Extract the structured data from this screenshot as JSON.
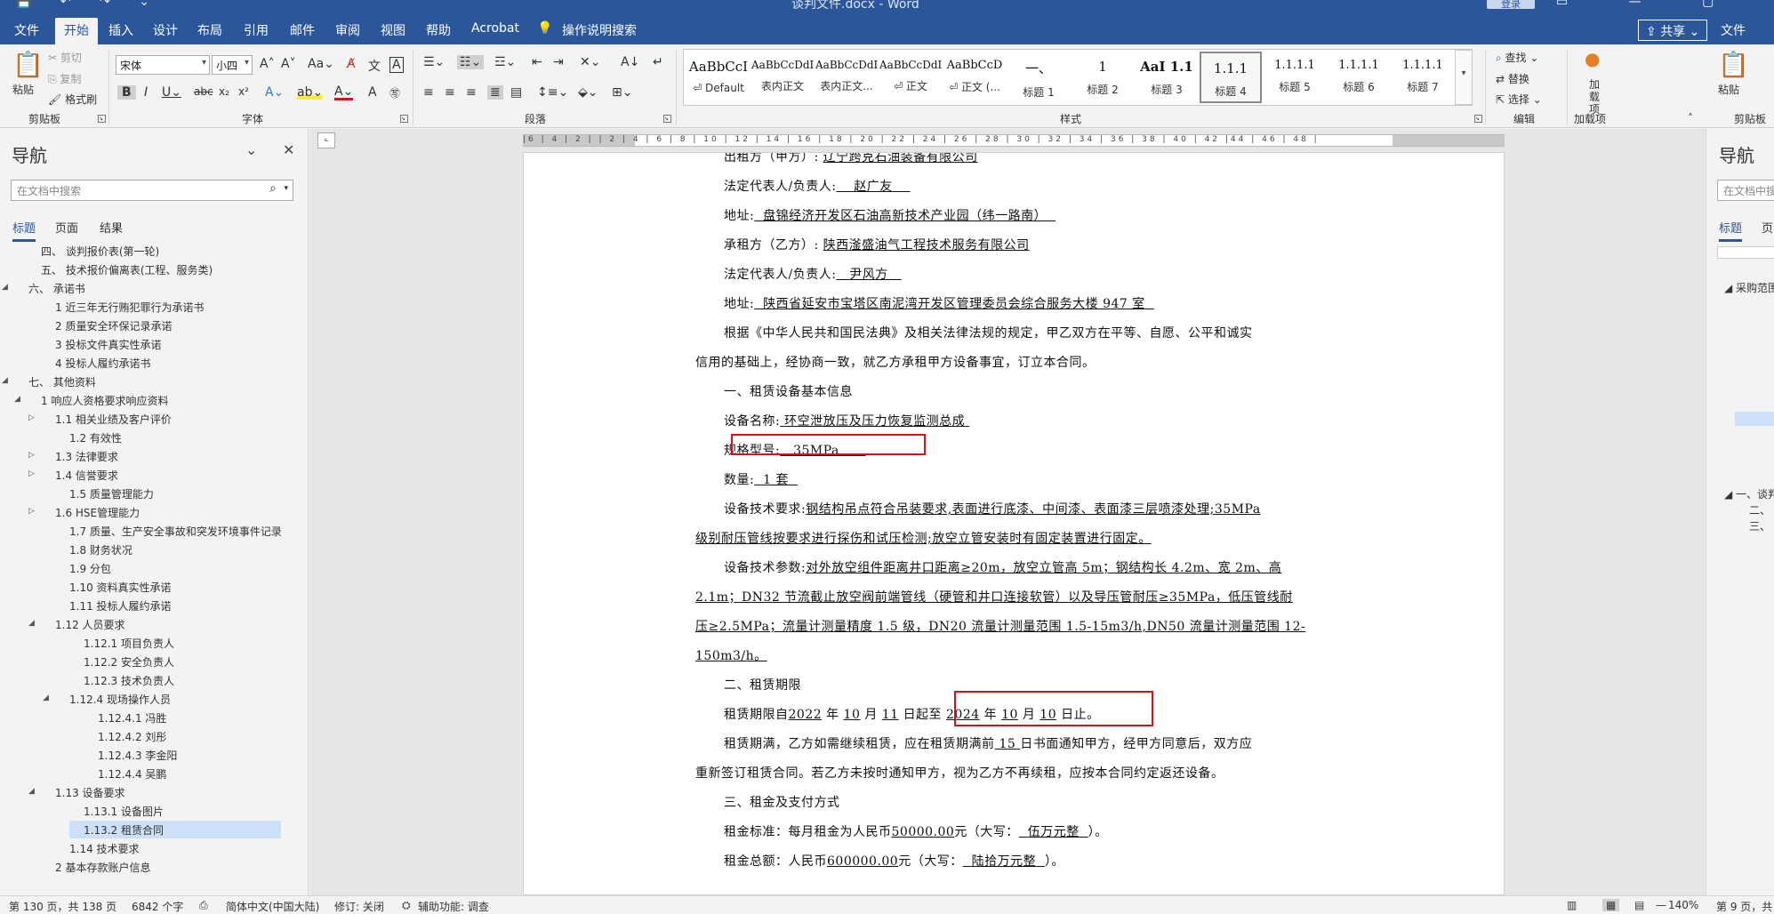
{
  "titlebar": {
    "title": "谈判文件.docx - Word",
    "login": "登录",
    "quick_access": "💾 ↶ ↷ ⌄"
  },
  "menu": {
    "tabs": [
      "文件",
      "开始",
      "插入",
      "设计",
      "布局",
      "引用",
      "邮件",
      "审阅",
      "视图",
      "帮助",
      "Acrobat"
    ],
    "tell_me": "操作说明搜索",
    "share": "共享",
    "right_file": "文件"
  },
  "ribbon": {
    "clipboard": {
      "paste": "粘贴",
      "cut": "剪切",
      "copy": "复制",
      "format_painter": "格式刷",
      "label": "剪贴板"
    },
    "font": {
      "name": "宋体",
      "size": "小四",
      "label": "字体"
    },
    "paragraph": {
      "label": "段落"
    },
    "styles": {
      "label": "样式",
      "items": [
        {
          "sample": "AaBbCcI",
          "name": "⏎ Default"
        },
        {
          "sample": "AaBbCcDdI",
          "name": "表内正文"
        },
        {
          "sample": "AaBbCcDdI",
          "name": "表内正文..."
        },
        {
          "sample": "AaBbCcDdI",
          "name": "⏎ 正文"
        },
        {
          "sample": "AaBbCcD",
          "name": "⏎ 正文 (..."
        },
        {
          "sample": "一、",
          "name": "标题 1"
        },
        {
          "sample": "1",
          "name": "标题 2"
        },
        {
          "sample": "AaI",
          "name": "标题 3"
        },
        {
          "sample": "1.1.1",
          "name": "标题 4"
        },
        {
          "sample": "1.1.1.1",
          "name": "标题 5"
        },
        {
          "sample": "1.1.1.1",
          "name": "标题 6"
        },
        {
          "sample": "1.1.1.1",
          "name": "标题 7"
        }
      ],
      "level_samples": [
        "1.1",
        "1.1",
        "1.1"
      ]
    },
    "editing": {
      "find": "查找",
      "replace": "替换",
      "select": "选择",
      "label": "编辑"
    },
    "addins": {
      "button": "加载项",
      "label": "加载项"
    },
    "right_partial": {
      "paste": "粘贴",
      "label": "剪贴板"
    }
  },
  "nav": {
    "title": "导航",
    "search_placeholder": "在文档中搜索",
    "tabs": [
      "标题",
      "页面",
      "结果"
    ],
    "tree": [
      {
        "text": "四、 谈判报价表(第一轮)",
        "level": 1,
        "twist": ""
      },
      {
        "text": "五、 技术报价偏离表(工程、服务类)",
        "level": 1,
        "twist": ""
      },
      {
        "text": "六、 承诺书",
        "level": 0,
        "twist": "◢"
      },
      {
        "text": "1 近三年无行贿犯罪行为承诺书",
        "level": 2,
        "twist": ""
      },
      {
        "text": "2 质量安全环保记录承诺",
        "level": 2,
        "twist": ""
      },
      {
        "text": "3 投标文件真实性承诺",
        "level": 2,
        "twist": ""
      },
      {
        "text": "4 投标人履约承诺书",
        "level": 2,
        "twist": ""
      },
      {
        "text": "七、 其他资料",
        "level": 0,
        "twist": "◢"
      },
      {
        "text": "1 响应人资格要求响应资料",
        "level": 1,
        "twist": "◢"
      },
      {
        "text": "1.1 相关业绩及客户评价",
        "level": 2,
        "twist": "▷"
      },
      {
        "text": "1.2 有效性",
        "level": 3,
        "twist": ""
      },
      {
        "text": "1.3 法律要求",
        "level": 2,
        "twist": "▷"
      },
      {
        "text": "1.4 信誉要求",
        "level": 2,
        "twist": "▷"
      },
      {
        "text": "1.5 质量管理能力",
        "level": 3,
        "twist": ""
      },
      {
        "text": "1.6 HSE管理能力",
        "level": 2,
        "twist": "▷"
      },
      {
        "text": "1.7 质量、生产安全事故和突发环境事件记录",
        "level": 3,
        "twist": ""
      },
      {
        "text": "1.8 财务状况",
        "level": 3,
        "twist": ""
      },
      {
        "text": "1.9 分包",
        "level": 3,
        "twist": ""
      },
      {
        "text": "1.10 资料真实性承诺",
        "level": 3,
        "twist": ""
      },
      {
        "text": "1.11 投标人履约承诺",
        "level": 3,
        "twist": ""
      },
      {
        "text": "1.12 人员要求",
        "level": 2,
        "twist": "◢"
      },
      {
        "text": "1.12.1 项目负责人",
        "level": 4,
        "twist": ""
      },
      {
        "text": "1.12.2 安全负责人",
        "level": 4,
        "twist": ""
      },
      {
        "text": "1.12.3 技术负责人",
        "level": 4,
        "twist": ""
      },
      {
        "text": "1.12.4 现场操作人员",
        "level": 3,
        "twist": "◢"
      },
      {
        "text": "1.12.4.1 冯胜",
        "level": 5,
        "twist": ""
      },
      {
        "text": "1.12.4.2 刘彤",
        "level": 5,
        "twist": ""
      },
      {
        "text": "1.12.4.3 李金阳",
        "level": 5,
        "twist": ""
      },
      {
        "text": "1.12.4.4 吴鹏",
        "level": 5,
        "twist": ""
      },
      {
        "text": "1.13 设备要求",
        "level": 2,
        "twist": "◢"
      },
      {
        "text": "1.13.1 设备图片",
        "level": 4,
        "twist": ""
      },
      {
        "text": "1.13.2 租赁合同",
        "level": 4,
        "twist": "",
        "selected": true
      },
      {
        "text": "1.14 技术要求",
        "level": 3,
        "twist": ""
      },
      {
        "text": "2 基本存款账户信息",
        "level": 2,
        "twist": ""
      }
    ]
  },
  "ruler": {
    "text": "|6 | 4 | 2 |  | 2 | 4 | 6 | 8 | 10 | 12 | 14 | 16 | 18 | 20 | 22 | 24 | 26 | 28 | 30 | 32 | 34 | 36 | 38 | 40 | 42 |44 | 46 | 48 |"
  },
  "doc": {
    "line_top": {
      "label": "出租方（甲方）:",
      "value": "辽宁跨克石油装备有限公司"
    },
    "lessor_rep": {
      "label": "法定代表人/负责人:",
      "value": "赵广友"
    },
    "lessor_addr": {
      "label": "地址:",
      "value": "盘锦经济开发区石油高新技术产业园（纬一路南）"
    },
    "lessee": {
      "label": "承租方（乙方）:",
      "value": "陕西滏盛油气工程技术服务有限公司"
    },
    "lessee_rep": {
      "label": "法定代表人/负责人:",
      "value": "尹风方"
    },
    "lessee_addr": {
      "label": "地址:",
      "value": "陕西省延安市宝塔区南泥湾开发区管理委员会综合服务大楼 947 室"
    },
    "preamble_1": "根据《中华人民共和国民法典》及相关法律法规的规定，甲乙双方在平等、自愿、公平和诚实",
    "preamble_2": "信用的基础上，经协商一致，就乙方承租甲方设备事宜，订立本合同。",
    "sec1": "一、租赁设备基本信息",
    "equip_name": {
      "label": "设备名称:",
      "value": "环空泄放压及压力恢复监测总成"
    },
    "spec": {
      "label": "规格型号:",
      "value": "35MPa"
    },
    "qty": {
      "label": "数量:",
      "value": "1 套"
    },
    "req_label": "设备技术要求:",
    "req_1": "钢结构吊点符合吊装要求,表面进行底漆、中间漆、表面漆三层喷漆处理;35MPa",
    "req_2": "级别耐压管线按要求进行探伤和试压检测;放空立管安装时有固定装置进行固定。",
    "param_label": "设备技术参数:",
    "param_1": "对外放空组件距离井口距离≥20m，放空立管高 5m；钢结构长 4.2m、宽 2m、高",
    "param_2": "2.1m；DN32 节流截止放空阀前端管线（硬管和井口连接软管）以及导压管耐压≥35MPa，低压管线耐",
    "param_3": "压≥2.5MPa；流量计测量精度 1.5 级，DN20 流量计测量范围 1.5-15m3/h,DN50 流量计测量范围 12-",
    "param_4": "150m3/h。",
    "sec2": "二、租赁期限",
    "term": {
      "prefix": "租赁期限自",
      "y1": "2022",
      "m1": "10",
      "d1": "11",
      "mid": "日起至",
      "y2": "2024",
      "m2": "10",
      "d2": "10",
      "suffix": "日止。",
      "unit_year": "年",
      "unit_month": "月"
    },
    "renew_1a": "租赁期满，乙方如需继续租赁，应在租赁期满前",
    "renew_days": "15",
    "renew_1b": "日书面通知甲方，经甲方同意后，双方应",
    "renew_2": "重新签订租赁合同。若乙方未按时通知甲方，视为乙方不再续租，应按本合同约定返还设备。",
    "sec3": "三、租金及支付方式",
    "rent_std": {
      "prefix": "租金标准：每月租金为人民币",
      "amount": "50000.00",
      "unit": "元（大写：",
      "words": "伍万元整",
      "suffix": "）。"
    },
    "rent_total": {
      "prefix": "租金总额：人民币",
      "amount": "600000.00",
      "unit": "元（大写：",
      "words": "陆拾万元整",
      "suffix": "）。"
    }
  },
  "rightpane": {
    "title": "导航",
    "search_placeholder": "在文档中搜",
    "tab_headings": "标题",
    "tab_pages": "页",
    "item_1": "◢ 采购范围",
    "item_2": "◢ 一、谈判",
    "item_3": "二、",
    "item_4": "三、"
  },
  "status": {
    "page": "第 130 页，共 138 页",
    "words": "6842 个字",
    "lang": "简体中文(中国大陆)",
    "track": "修订: 关闭",
    "access": "辅助功能: 调查",
    "zoom": "140%",
    "right_page": "第 9 页，共"
  },
  "colors": {
    "brand": "#2b579a",
    "highlight_box": "#d4121c",
    "nav_selected": "#cce0f7"
  }
}
